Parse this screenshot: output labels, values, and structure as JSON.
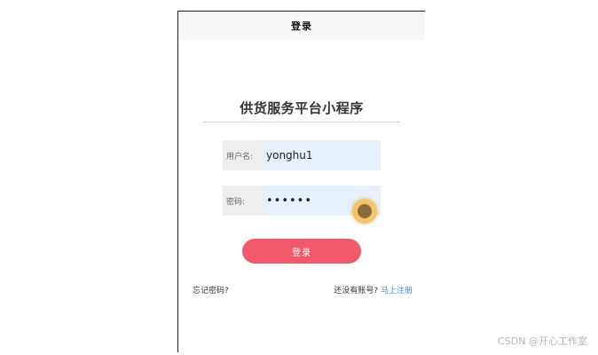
{
  "nav": {
    "title": "登录"
  },
  "app": {
    "title": "供货服务平台小程序"
  },
  "form": {
    "username_label": "用户名:",
    "username_value": "yonghu1",
    "password_label": "密码:",
    "password_value": "••••••",
    "login_label": "登录"
  },
  "footer": {
    "forgot_label": "忘记密码?",
    "no_account_label": "还没有账号?",
    "register_label": "马上注册"
  },
  "watermark": {
    "text": "CSDN @开心工作室"
  },
  "colors": {
    "accent": "#f05a6a",
    "link": "#3a8fd8",
    "input_bg": "#e6f0fb"
  }
}
